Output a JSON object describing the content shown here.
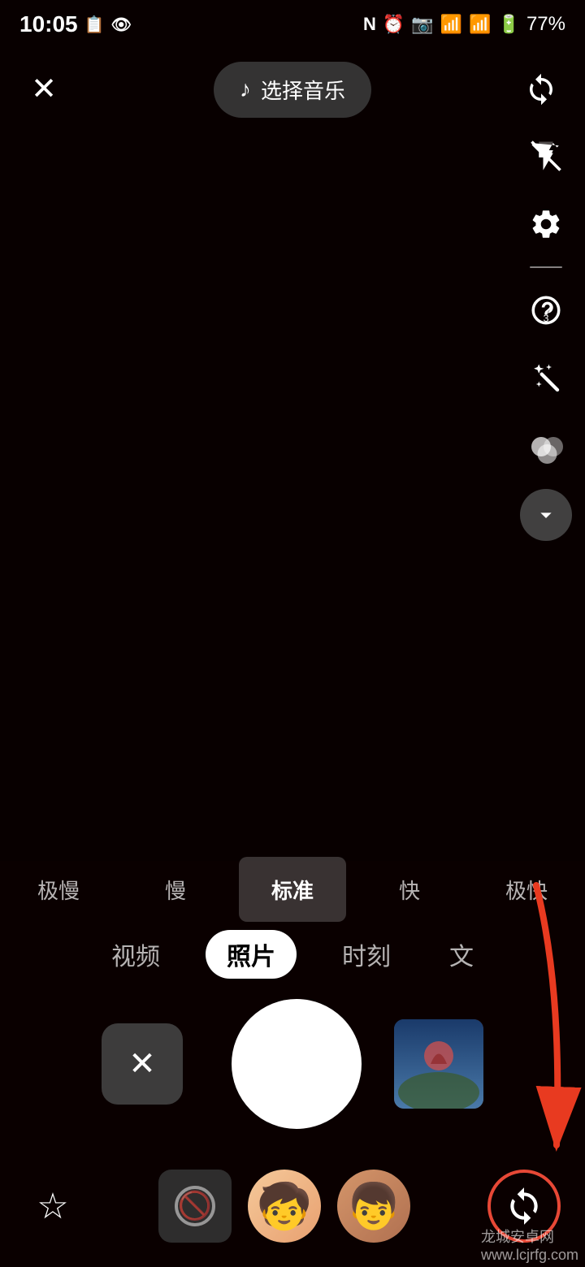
{
  "status_bar": {
    "time": "10:05",
    "battery_percent": "77%"
  },
  "top_bar": {
    "close_label": "×",
    "music_note": "♪",
    "music_label": "选择音乐",
    "refresh_icon": "↻"
  },
  "right_tools": {
    "flash_icon": "flash-off",
    "settings_icon": "gear",
    "timer_icon": "timer-3",
    "beauty_icon": "sparkle-wand",
    "color_icon": "color-circles",
    "expand_icon": "chevron-down"
  },
  "speed_options": [
    {
      "label": "极慢",
      "active": false
    },
    {
      "label": "慢",
      "active": false
    },
    {
      "label": "标准",
      "active": true
    },
    {
      "label": "快",
      "active": false
    },
    {
      "label": "极快",
      "active": false
    }
  ],
  "mode_tabs": [
    {
      "label": "视频",
      "active": false
    },
    {
      "label": "照片",
      "active": true
    },
    {
      "label": "时刻",
      "active": false
    },
    {
      "label": "文",
      "active": false
    }
  ],
  "camera_controls": {
    "cancel_icon": "×",
    "gallery_thumb_alt": "video thumbnail"
  },
  "bottom_filters": {
    "favorite_icon": "☆",
    "no_filter_label": "无",
    "refresh_label": "↻"
  },
  "watermark": {
    "text": "龙城安卓网",
    "url_text": "www.lcjrfg.com"
  }
}
